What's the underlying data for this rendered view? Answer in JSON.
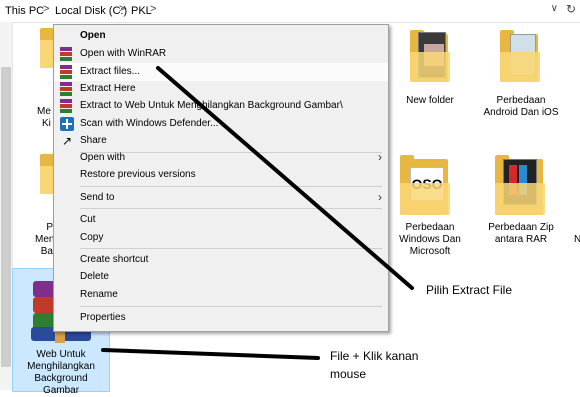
{
  "breadcrumb": {
    "items": [
      "This PC",
      "Local Disk (C:)",
      "PKL"
    ],
    "separator": ">"
  },
  "context_menu": {
    "items": [
      {
        "label": "Open",
        "bold": true
      },
      {
        "label": "Open with WinRAR",
        "icon": "winrar-icon"
      },
      {
        "label": "Extract files...",
        "icon": "winrar-icon",
        "highlighted": true
      },
      {
        "label": "Extract Here",
        "icon": "winrar-icon"
      },
      {
        "label": "Extract to Web Untuk Menghilangkan Background Gambar\\",
        "icon": "winrar-icon"
      },
      {
        "label": "Scan with Windows Defender...",
        "icon": "windows-defender-icon"
      },
      {
        "label": "Share",
        "icon": "share-icon"
      },
      {
        "label": "Open with",
        "submenu": true
      },
      {
        "label": "Restore previous versions"
      },
      {
        "label": "Send to",
        "submenu": true
      },
      {
        "label": "Cut"
      },
      {
        "label": "Copy"
      },
      {
        "label": "Create shortcut"
      },
      {
        "label": "Delete"
      },
      {
        "label": "Rename"
      },
      {
        "label": "Properties"
      }
    ]
  },
  "files": {
    "partial_left_1": [
      "Me",
      "Ki"
    ],
    "partial_left_2": [
      "P",
      "Men",
      "Ba"
    ],
    "new_folder": "New folder",
    "perbedaan_android": [
      "Perbedaan",
      "Android Dan iOS"
    ],
    "perbedaan_windows": [
      "Perbedaan",
      "Windows Dan",
      "Microsoft"
    ],
    "perbedaan_zip": [
      "Perbedaan Zip",
      "antara RAR"
    ],
    "partial_right": "N",
    "selected_file": [
      "Web Untuk",
      "Menghilangkan",
      "Background",
      "Gambar"
    ]
  },
  "annotations": {
    "pilih": "Pilih Extract File",
    "file_klik": [
      "File + Klik kanan",
      "mouse"
    ]
  },
  "colors": {
    "menu_bg": "#f0f0f0",
    "selection": "#cce8ff",
    "folder": "#f9d775"
  }
}
